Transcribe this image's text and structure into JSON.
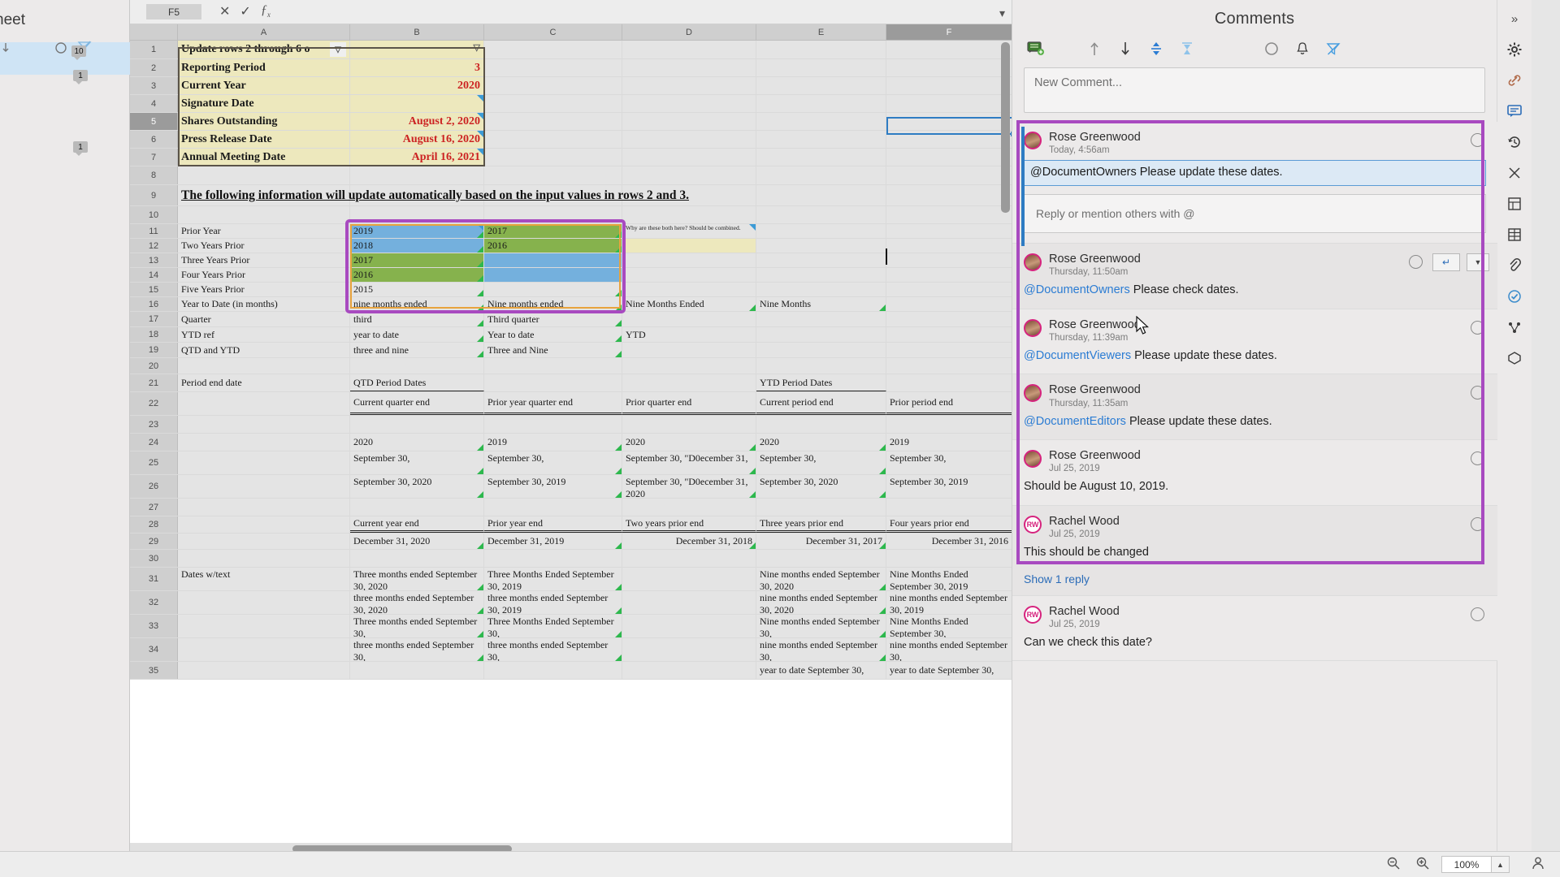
{
  "formula_bar": {
    "name_box": "F5",
    "cancel_icon": "cancel-icon",
    "accept_icon": "accept-icon",
    "function_icon": "fx",
    "expand_icon": "chevron-down-icon"
  },
  "grid": {
    "columns": [
      "A",
      "B",
      "C",
      "D",
      "E",
      "F"
    ],
    "selected_column": "F",
    "selected_row": "5",
    "rows": [
      {
        "n": "1",
        "a": "Update rows 2 through 6 o",
        "b": "",
        "c": "",
        "d": "",
        "e": "",
        "f": ""
      },
      {
        "n": "2",
        "a": "Reporting Period",
        "b": "3",
        "c": "",
        "d": "",
        "e": "",
        "f": ""
      },
      {
        "n": "3",
        "a": "Current Year",
        "b": "2020",
        "c": "",
        "d": "",
        "e": "",
        "f": ""
      },
      {
        "n": "4",
        "a": "Signature Date",
        "b": "",
        "c": "",
        "d": "",
        "e": "",
        "f": ""
      },
      {
        "n": "5",
        "a": "Shares Outstanding",
        "b": "August 2, 2020",
        "c": "",
        "d": "",
        "e": "",
        "f": ""
      },
      {
        "n": "6",
        "a": "Press Release Date",
        "b": "August 16, 2020",
        "c": "",
        "d": "",
        "e": "",
        "f": ""
      },
      {
        "n": "7",
        "a": "Annual Meeting Date",
        "b": "April 16, 2021",
        "c": "",
        "d": "",
        "e": "",
        "f": ""
      },
      {
        "n": "8",
        "a": "",
        "b": "",
        "c": "",
        "d": "",
        "e": "",
        "f": ""
      },
      {
        "n": "9",
        "a": "The following information will update automatically based on the input values in rows 2 and 3.",
        "b": "",
        "c": "",
        "d": "",
        "e": "",
        "f": ""
      },
      {
        "n": "10",
        "a": "",
        "b": "",
        "c": "",
        "d": "",
        "e": "",
        "f": ""
      },
      {
        "n": "11",
        "a": "Prior Year",
        "b": "2019",
        "c": "2017",
        "d": "Why are these both here?  Should be combined.",
        "e": "",
        "f": ""
      },
      {
        "n": "12",
        "a": "Two Years Prior",
        "b": "2018",
        "c": "2016",
        "d": "",
        "e": "",
        "f": ""
      },
      {
        "n": "13",
        "a": "Three Years Prior",
        "b": "2017",
        "c": "",
        "d": "",
        "e": "",
        "f": ""
      },
      {
        "n": "14",
        "a": "Four Years Prior",
        "b": "2016",
        "c": "",
        "d": "",
        "e": "",
        "f": ""
      },
      {
        "n": "15",
        "a": "Five Years Prior",
        "b": "2015",
        "c": "",
        "d": "",
        "e": "",
        "f": ""
      },
      {
        "n": "16",
        "a": "Year to Date (in months)",
        "b": "nine months ended",
        "c": "Nine months ended",
        "d": "Nine Months Ended",
        "e": "Nine Months",
        "f": ""
      },
      {
        "n": "17",
        "a": "Quarter",
        "b": "third",
        "c": "Third quarter",
        "d": "",
        "e": "",
        "f": ""
      },
      {
        "n": "18",
        "a": "YTD ref",
        "b": "year to date",
        "c": "Year to date",
        "d": "YTD",
        "e": "",
        "f": ""
      },
      {
        "n": "19",
        "a": "QTD and YTD",
        "b": "three and nine",
        "c": "Three and Nine",
        "d": "",
        "e": "",
        "f": ""
      },
      {
        "n": "20",
        "a": "",
        "b": "",
        "c": "",
        "d": "",
        "e": "",
        "f": ""
      },
      {
        "n": "21",
        "a": "Period end date",
        "b": "QTD Period Dates",
        "c": "",
        "d": "",
        "e": "YTD Period Dates",
        "f": ""
      },
      {
        "n": "22",
        "a": "",
        "b": "Current quarter end",
        "c": "Prior year quarter end",
        "d": "Prior quarter end",
        "e": "Current period end",
        "f": "Prior period end"
      },
      {
        "n": "23",
        "a": "",
        "b": "",
        "c": "",
        "d": "",
        "e": "",
        "f": ""
      },
      {
        "n": "24",
        "a": "",
        "b": "2020",
        "c": "2019",
        "d": "2020",
        "e": "2020",
        "f": "2019"
      },
      {
        "n": "25",
        "a": "",
        "b": "September 30,",
        "c": "September 30,",
        "d": "September 30, \"D0ecember 31,",
        "e": "September 30,",
        "f": "September 30,"
      },
      {
        "n": "26",
        "a": "",
        "b": "September 30, 2020",
        "c": "September 30, 2019",
        "d": "September 30, \"D0ecember 31, 2020",
        "e": "September 30, 2020",
        "f": "September 30, 2019"
      },
      {
        "n": "27",
        "a": "",
        "b": "",
        "c": "",
        "d": "",
        "e": "",
        "f": ""
      },
      {
        "n": "28",
        "a": "",
        "b": "Current year end",
        "c": "Prior year end",
        "d": "Two years prior end",
        "e": "Three years prior end",
        "f": "Four years prior end"
      },
      {
        "n": "29",
        "a": "",
        "b": "December 31, 2020",
        "c": "December 31, 2019",
        "d": "December 31, 2018",
        "e": "December 31, 2017",
        "f": "December 31, 2016"
      },
      {
        "n": "30",
        "a": "",
        "b": "",
        "c": "",
        "d": "",
        "e": "",
        "f": ""
      },
      {
        "n": "31",
        "a": "Dates w/text",
        "b": "Three months ended September 30, 2020",
        "c": "Three Months Ended September 30, 2019",
        "d": "",
        "e": "Nine months ended September 30, 2020",
        "f": "Nine Months Ended September 30, 2019"
      },
      {
        "n": "32",
        "a": "",
        "b": "three months ended September 30, 2020",
        "c": "three months ended September 30, 2019",
        "d": "",
        "e": "nine months ended September 30, 2020",
        "f": "nine months ended September 30, 2019"
      },
      {
        "n": "33",
        "a": "",
        "b": "Three months ended September 30,",
        "c": "Three Months Ended September 30,",
        "d": "",
        "e": "Nine months ended September 30,",
        "f": "Nine Months Ended September 30,"
      },
      {
        "n": "34",
        "a": "",
        "b": "three months ended September 30,",
        "c": "three months ended September 30,",
        "d": "",
        "e": "nine months ended September 30,",
        "f": "nine months ended September 30,"
      },
      {
        "n": "35",
        "a": "",
        "b": "",
        "c": "",
        "d": "",
        "e": "year to date September 30,",
        "f": "year to date September 30,"
      }
    ],
    "right_edge_partials": {
      "r22": "P e",
      "r25": "S 3 2",
      "r29": "D"
    }
  },
  "left_rail": {
    "title": "heet",
    "badges": [
      {
        "count": "10"
      },
      {
        "count": "1"
      },
      {
        "count": "1"
      }
    ]
  },
  "comments": {
    "title": "Comments",
    "toolbar": [
      {
        "name": "new-comment-icon",
        "glyph": "💬"
      },
      {
        "name": "previous-comment-icon",
        "glyph": "↑"
      },
      {
        "name": "next-comment-icon",
        "glyph": "↓"
      },
      {
        "name": "expand-all-icon",
        "glyph": "⇕"
      },
      {
        "name": "collapse-all-icon",
        "glyph": "⇵"
      },
      {
        "name": "resolve-icon",
        "glyph": "○"
      },
      {
        "name": "notifications-icon",
        "glyph": "🔔"
      },
      {
        "name": "filter-off-icon",
        "glyph": "▽"
      }
    ],
    "new_comment_placeholder": "New Comment...",
    "reply_placeholder": "Reply or mention others with @",
    "items": [
      {
        "author": "Rose Greenwood",
        "time": "Today, 4:56am",
        "mention": "@DocumentOwners",
        "text": " Please update these dates.",
        "editing": true,
        "avatar_type": "photo",
        "has_reply_box": true,
        "highlighted": true
      },
      {
        "author": "Rose Greenwood",
        "time": "Thursday, 11:50am",
        "mention": "@DocumentOwners",
        "text": " Please check dates.",
        "editing": false,
        "avatar_type": "photo",
        "has_reply_box": false,
        "highlighted": true,
        "has_action_buttons": true
      },
      {
        "author": "Rose Greenwood",
        "time": "Thursday, 11:39am",
        "mention": "@DocumentViewers",
        "text": " Please update these dates.",
        "editing": false,
        "avatar_type": "photo",
        "has_reply_box": false,
        "highlighted": true
      },
      {
        "author": "Rose Greenwood",
        "time": "Thursday, 11:35am",
        "mention": "@DocumentEditors",
        "text": " Please update these dates.",
        "editing": false,
        "avatar_type": "photo",
        "has_reply_box": false,
        "highlighted": true
      },
      {
        "author": "Rose Greenwood",
        "time": "Jul 25, 2019",
        "mention": "",
        "text": "Should be August 10, 2019.",
        "editing": false,
        "avatar_type": "photo",
        "has_reply_box": false,
        "highlighted": true
      },
      {
        "author": "Rachel Wood",
        "time": "Jul 25, 2019",
        "mention": "",
        "text": "This should be changed",
        "editing": false,
        "avatar_type": "initials",
        "initials": "RW",
        "has_reply_box": false,
        "highlighted": false,
        "show_reply_label": "Show 1 reply"
      },
      {
        "author": "Rachel Wood",
        "time": "Jul 25, 2019",
        "mention": "",
        "text": "Can we check this date?",
        "editing": false,
        "avatar_type": "initials",
        "initials": "RW",
        "has_reply_box": false,
        "highlighted": false
      }
    ]
  },
  "right_icons": [
    {
      "name": "expand-panel-icon",
      "glyph": "»"
    },
    {
      "name": "settings-gear-icon",
      "glyph": "⚙"
    },
    {
      "name": "link-icon",
      "glyph": "🔗"
    },
    {
      "name": "comments-panel-icon",
      "glyph": "💬"
    },
    {
      "name": "history-icon",
      "glyph": "↺"
    },
    {
      "name": "formula-cut-icon",
      "glyph": "✂"
    },
    {
      "name": "structure-icon",
      "glyph": "▤"
    },
    {
      "name": "table-icon",
      "glyph": "▦"
    },
    {
      "name": "attachment-icon",
      "glyph": "📎"
    },
    {
      "name": "validation-icon",
      "glyph": "✓"
    },
    {
      "name": "relations-icon",
      "glyph": "∴"
    },
    {
      "name": "cube-icon",
      "glyph": "⬡"
    }
  ],
  "status_bar": {
    "zoom_out_icon": "zoom-out-icon",
    "zoom_in_icon": "zoom-in-icon",
    "zoom_level": "100%",
    "zoom_stepper_icon": "chevron-up-icon",
    "account_icon": "user-account-icon"
  },
  "colors": {
    "accent_purple": "#a84ac0",
    "accent_blue": "#2e7cc3",
    "input_yellow": "#ede8bd",
    "cell_blue": "#74b0dd",
    "cell_green": "#86b24d",
    "value_red": "#cc2222",
    "mention_blue": "#2b7cd3"
  }
}
